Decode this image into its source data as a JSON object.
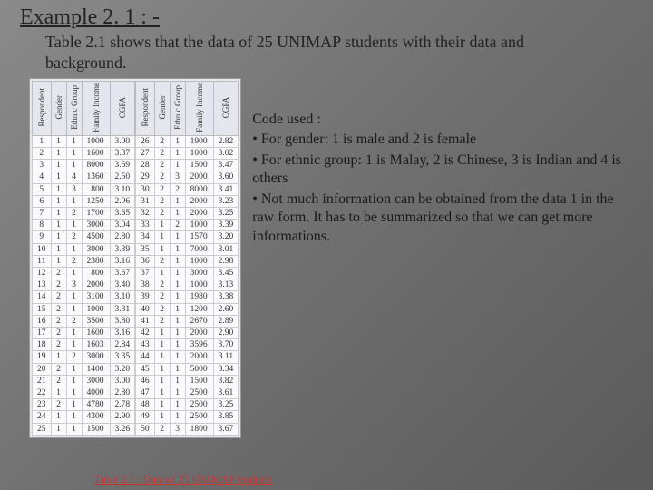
{
  "title": "Example 2. 1 : -",
  "subtitle": "Table 2.1 shows that the data of 25 UNIMAP students with their data and background.",
  "headers": [
    "Respondent",
    "Gender",
    "Ethnic Group",
    "Family Income",
    "CGPA"
  ],
  "rows_left": [
    [
      1,
      1,
      1,
      1000,
      "3.00"
    ],
    [
      2,
      1,
      1,
      1600,
      "3.37"
    ],
    [
      3,
      1,
      1,
      8000,
      "3.59"
    ],
    [
      4,
      1,
      4,
      1360,
      "2.50"
    ],
    [
      5,
      1,
      3,
      800,
      "3.10"
    ],
    [
      6,
      1,
      1,
      1250,
      "2.96"
    ],
    [
      7,
      1,
      2,
      1700,
      "3.65"
    ],
    [
      8,
      1,
      1,
      3000,
      "3.04"
    ],
    [
      9,
      1,
      2,
      4500,
      "2.80"
    ],
    [
      10,
      1,
      1,
      3000,
      "3.39"
    ],
    [
      11,
      1,
      2,
      2380,
      "3.16"
    ],
    [
      12,
      2,
      1,
      800,
      "3.67"
    ],
    [
      13,
      2,
      3,
      2000,
      "3.40"
    ],
    [
      14,
      2,
      1,
      3100,
      "3.10"
    ],
    [
      15,
      2,
      1,
      1000,
      "3.31"
    ],
    [
      16,
      2,
      2,
      3500,
      "3.80"
    ],
    [
      17,
      2,
      1,
      1600,
      "3.16"
    ],
    [
      18,
      2,
      1,
      1603,
      "2.84"
    ],
    [
      19,
      1,
      2,
      3000,
      "3.35"
    ],
    [
      20,
      2,
      1,
      1400,
      "3.20"
    ],
    [
      21,
      2,
      1,
      3000,
      "3.00"
    ],
    [
      22,
      1,
      1,
      4000,
      "2.80"
    ],
    [
      23,
      2,
      1,
      4780,
      "2.78"
    ],
    [
      24,
      1,
      1,
      4300,
      "2.90"
    ],
    [
      25,
      1,
      1,
      1500,
      "3.26"
    ]
  ],
  "rows_right": [
    [
      26,
      2,
      1,
      1900,
      "2.82"
    ],
    [
      27,
      2,
      1,
      1000,
      "3.02"
    ],
    [
      28,
      2,
      1,
      1500,
      "3.47"
    ],
    [
      29,
      2,
      3,
      2000,
      "3.60"
    ],
    [
      30,
      2,
      2,
      8000,
      "3.41"
    ],
    [
      31,
      2,
      1,
      2000,
      "3.23"
    ],
    [
      32,
      2,
      1,
      2000,
      "3.25"
    ],
    [
      33,
      1,
      2,
      1000,
      "3.39"
    ],
    [
      34,
      1,
      1,
      1570,
      "3.20"
    ],
    [
      35,
      1,
      1,
      7000,
      "3.01"
    ],
    [
      36,
      2,
      1,
      1000,
      "2.98"
    ],
    [
      37,
      1,
      1,
      3000,
      "3.45"
    ],
    [
      38,
      2,
      1,
      1000,
      "3.13"
    ],
    [
      39,
      2,
      1,
      1980,
      "3.38"
    ],
    [
      40,
      2,
      1,
      1200,
      "2.60"
    ],
    [
      41,
      2,
      1,
      2670,
      "2.89"
    ],
    [
      42,
      1,
      1,
      2000,
      "2.90"
    ],
    [
      43,
      1,
      1,
      3596,
      "3.70"
    ],
    [
      44,
      1,
      1,
      2000,
      "3.11"
    ],
    [
      45,
      1,
      1,
      5000,
      "3.34"
    ],
    [
      46,
      1,
      1,
      1500,
      "3.82"
    ],
    [
      47,
      1,
      1,
      2500,
      "3.61"
    ],
    [
      48,
      1,
      1,
      2500,
      "3.25"
    ],
    [
      49,
      1,
      1,
      2500,
      "3.85"
    ],
    [
      50,
      2,
      3,
      1800,
      "3.67"
    ]
  ],
  "notes": {
    "h": "Code used :",
    "b1": "• For gender: 1 is male and 2 is female",
    "b2": "• For ethnic group: 1 is Malay, 2 is Chinese, 3 is Indian and 4 is others",
    "b3": "• Not much information can be obtained from the data 1 in the raw form. It has to be summarized so that we can get more informations."
  },
  "caption": "Table 2.1 : Data of 25 UNIMAP students",
  "chart_data": {
    "type": "table",
    "title": "Table 2.1 : Data of 25 UNIMAP students",
    "columns": [
      "Respondent",
      "Gender",
      "Ethnic Group",
      "Family Income",
      "CGPA"
    ],
    "data": [
      [
        1,
        1,
        1,
        1000,
        3.0
      ],
      [
        2,
        1,
        1,
        1600,
        3.37
      ],
      [
        3,
        1,
        1,
        8000,
        3.59
      ],
      [
        4,
        1,
        4,
        1360,
        2.5
      ],
      [
        5,
        1,
        3,
        800,
        3.1
      ],
      [
        6,
        1,
        1,
        1250,
        2.96
      ],
      [
        7,
        1,
        2,
        1700,
        3.65
      ],
      [
        8,
        1,
        1,
        3000,
        3.04
      ],
      [
        9,
        1,
        2,
        4500,
        2.8
      ],
      [
        10,
        1,
        1,
        3000,
        3.39
      ],
      [
        11,
        1,
        2,
        2380,
        3.16
      ],
      [
        12,
        2,
        1,
        800,
        3.67
      ],
      [
        13,
        2,
        3,
        2000,
        3.4
      ],
      [
        14,
        2,
        1,
        3100,
        3.1
      ],
      [
        15,
        2,
        1,
        1000,
        3.31
      ],
      [
        16,
        2,
        2,
        3500,
        3.8
      ],
      [
        17,
        2,
        1,
        1600,
        3.16
      ],
      [
        18,
        2,
        1,
        1603,
        2.84
      ],
      [
        19,
        1,
        2,
        3000,
        3.35
      ],
      [
        20,
        2,
        1,
        1400,
        3.2
      ],
      [
        21,
        2,
        1,
        3000,
        3.0
      ],
      [
        22,
        1,
        1,
        4000,
        2.8
      ],
      [
        23,
        2,
        1,
        4780,
        2.78
      ],
      [
        24,
        1,
        1,
        4300,
        2.9
      ],
      [
        25,
        1,
        1,
        1500,
        3.26
      ],
      [
        26,
        2,
        1,
        1900,
        2.82
      ],
      [
        27,
        2,
        1,
        1000,
        3.02
      ],
      [
        28,
        2,
        1,
        1500,
        3.47
      ],
      [
        29,
        2,
        3,
        2000,
        3.6
      ],
      [
        30,
        2,
        2,
        8000,
        3.41
      ],
      [
        31,
        2,
        1,
        2000,
        3.23
      ],
      [
        32,
        2,
        1,
        2000,
        3.25
      ],
      [
        33,
        1,
        2,
        1000,
        3.39
      ],
      [
        34,
        1,
        1,
        1570,
        3.2
      ],
      [
        35,
        1,
        1,
        7000,
        3.01
      ],
      [
        36,
        2,
        1,
        1000,
        2.98
      ],
      [
        37,
        1,
        1,
        3000,
        3.45
      ],
      [
        38,
        2,
        1,
        1000,
        3.13
      ],
      [
        39,
        2,
        1,
        1980,
        3.38
      ],
      [
        40,
        2,
        1,
        1200,
        2.6
      ],
      [
        41,
        2,
        1,
        2670,
        2.89
      ],
      [
        42,
        1,
        1,
        2000,
        2.9
      ],
      [
        43,
        1,
        1,
        3596,
        3.7
      ],
      [
        44,
        1,
        1,
        2000,
        3.11
      ],
      [
        45,
        1,
        1,
        5000,
        3.34
      ],
      [
        46,
        1,
        1,
        1500,
        3.82
      ],
      [
        47,
        1,
        1,
        2500,
        3.61
      ],
      [
        48,
        1,
        1,
        2500,
        3.25
      ],
      [
        49,
        1,
        1,
        2500,
        3.85
      ],
      [
        50,
        2,
        3,
        1800,
        3.67
      ]
    ]
  }
}
